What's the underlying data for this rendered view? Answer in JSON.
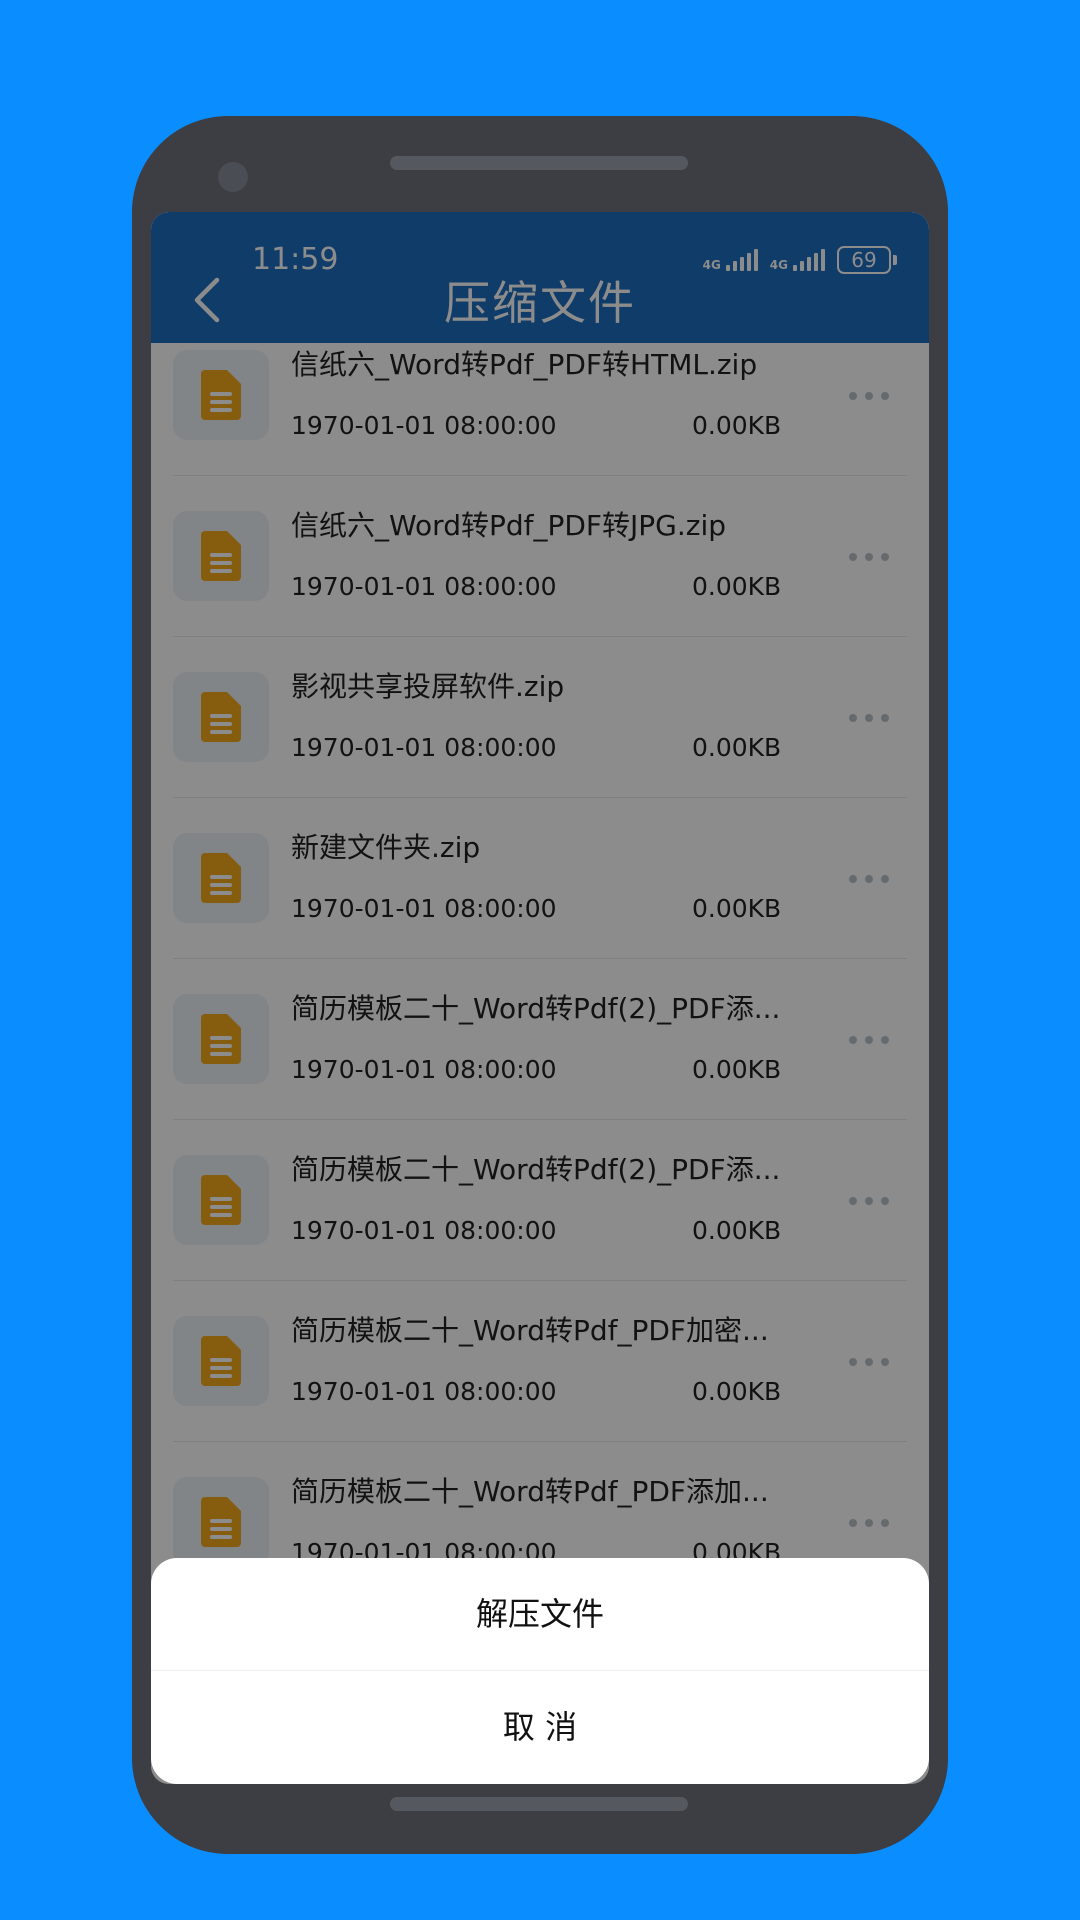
{
  "status_bar": {
    "time": "11:59",
    "signal1_label": "4G",
    "signal2_label": "4G",
    "battery": "69"
  },
  "header": {
    "title": "压缩文件",
    "back_icon": "chevron-left-icon"
  },
  "colors": {
    "header_bg": "#1e6dc0",
    "file_icon": "#f4a91c",
    "background": "#0a8eff"
  },
  "files": [
    {
      "name": "信纸六_Word转Pdf_PDF转HTML.zip",
      "date": "1970-01-01 08:00:00",
      "size": "0.00KB"
    },
    {
      "name": "信纸六_Word转Pdf_PDF转JPG.zip",
      "date": "1970-01-01 08:00:00",
      "size": "0.00KB"
    },
    {
      "name": "影视共享投屏软件.zip",
      "date": "1970-01-01 08:00:00",
      "size": "0.00KB"
    },
    {
      "name": "新建文件夹.zip",
      "date": "1970-01-01 08:00:00",
      "size": "0.00KB"
    },
    {
      "name": "简历模板二十_Word转Pdf(2)_PDF添...",
      "date": "1970-01-01 08:00:00",
      "size": "0.00KB"
    },
    {
      "name": "简历模板二十_Word转Pdf(2)_PDF添...",
      "date": "1970-01-01 08:00:00",
      "size": "0.00KB"
    },
    {
      "name": "简历模板二十_Word转Pdf_PDF加密...",
      "date": "1970-01-01 08:00:00",
      "size": "0.00KB"
    },
    {
      "name": "简历模板二十_Word转Pdf_PDF添加...",
      "date": "1970-01-01 08:00:00",
      "size": "0.00KB"
    }
  ],
  "action_sheet": {
    "extract_label": "解压文件",
    "cancel_label": "取 消"
  }
}
